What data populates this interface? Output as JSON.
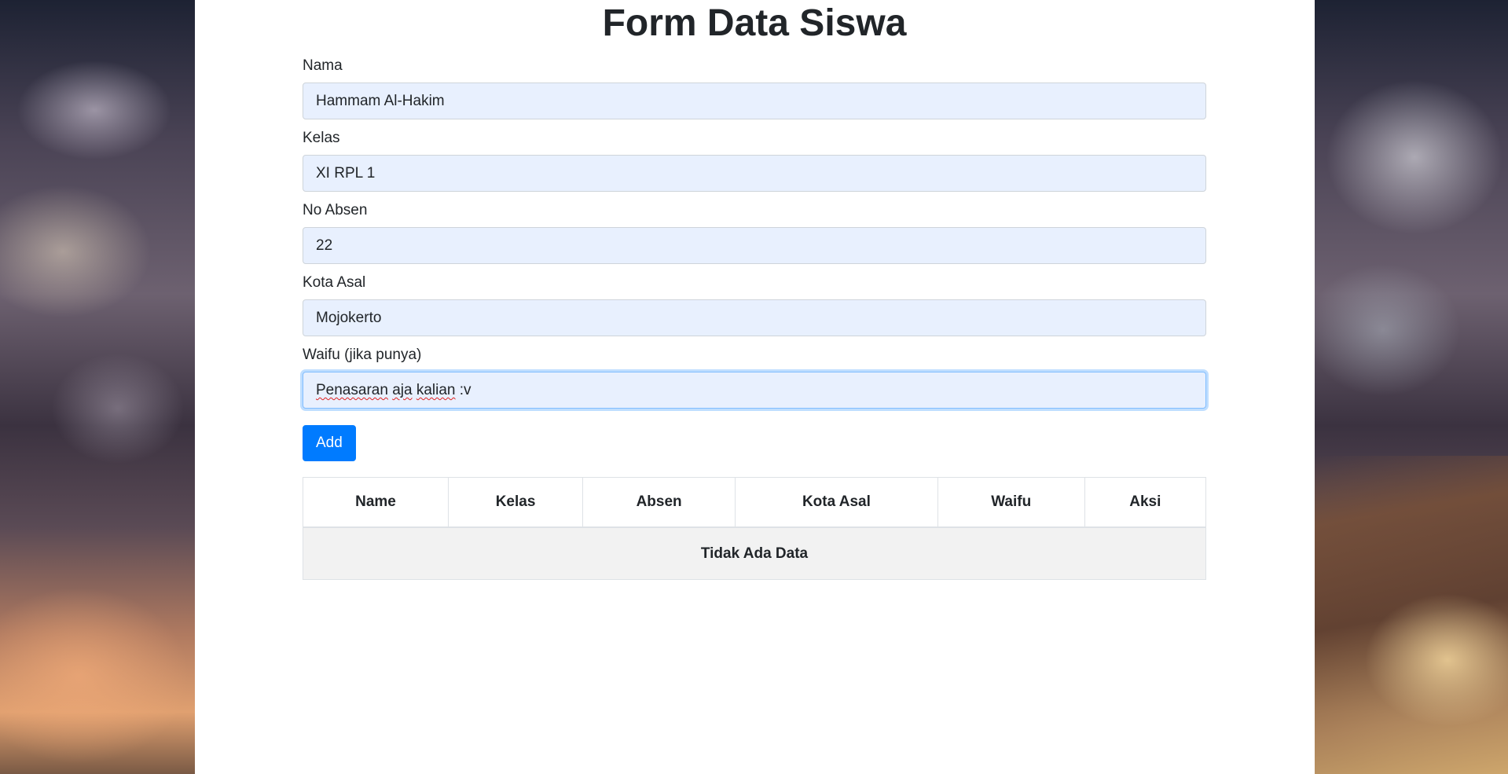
{
  "page": {
    "title": "Form Data Siswa"
  },
  "form": {
    "fields": [
      {
        "label": "Nama",
        "value": "Hammam Al-Hakim"
      },
      {
        "label": "Kelas",
        "value": "XI RPL 1"
      },
      {
        "label": "No Absen",
        "value": "22"
      },
      {
        "label": "Kota Asal",
        "value": "Mojokerto"
      },
      {
        "label": "Waifu (jika punya)",
        "value_word1": "Penasaran",
        "value_word2": "aja",
        "value_word3": "kalian",
        "value_rest": ":v"
      }
    ],
    "submit_label": "Add"
  },
  "table": {
    "headers": [
      "Name",
      "Kelas",
      "Absen",
      "Kota Asal",
      "Waifu",
      "Aksi"
    ],
    "empty_message": "Tidak Ada Data"
  },
  "colors": {
    "primary": "#007bff",
    "input_bg": "#e8f0fe",
    "focus_border": "#80bdff"
  }
}
